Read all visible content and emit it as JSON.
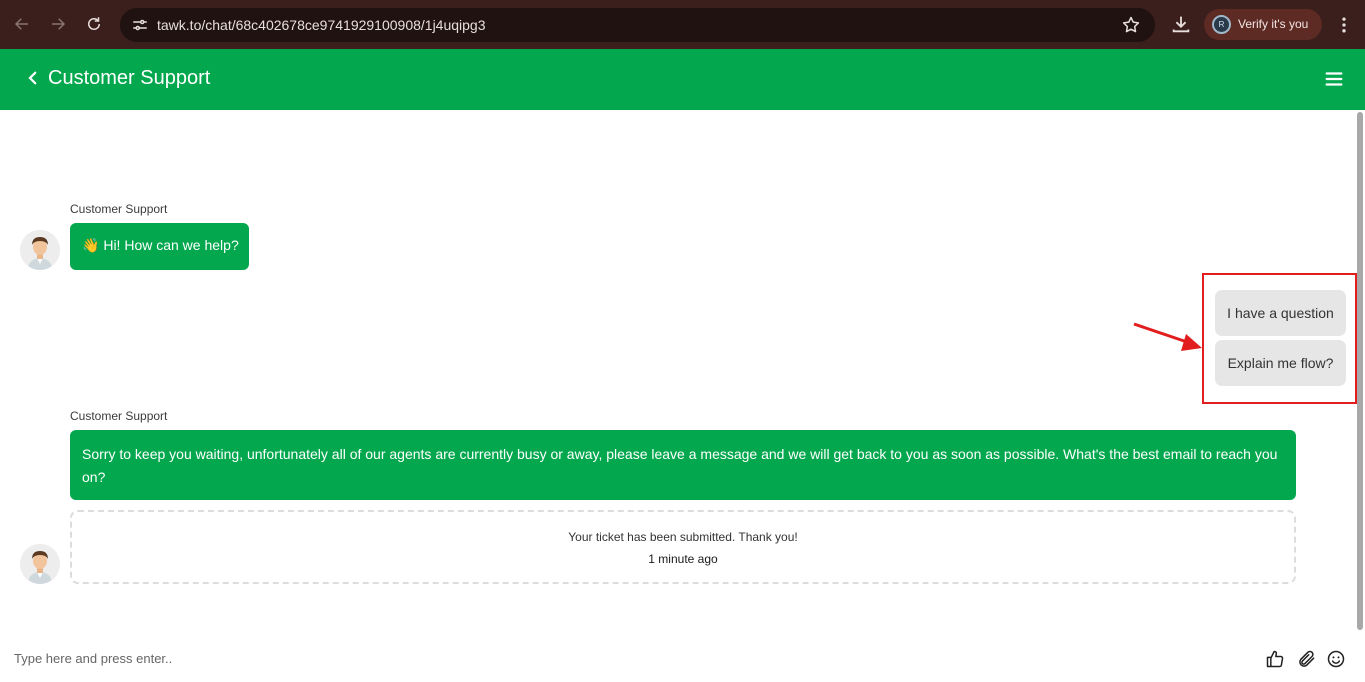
{
  "browser": {
    "url": "tawk.to/chat/68c402678ce9741929100908/1j4uqipg3",
    "profile_initial": "R",
    "verify_label": "Verify it's you"
  },
  "header": {
    "title": "Customer Support"
  },
  "messages": [
    {
      "sender": "Customer Support",
      "emoji": "👋",
      "text": "Hi! How can we help?"
    },
    {
      "sender": "Customer Support",
      "text": "Sorry to keep you waiting, unfortunately all of our agents are currently busy or away, please leave a message and we will get back to you as soon as possible. What's the best email to reach you on?"
    }
  ],
  "quick_replies": [
    "I have a question",
    "Explain me flow?"
  ],
  "ticket": {
    "message": "Your ticket has been submitted. Thank you!",
    "time": "1 minute ago"
  },
  "input": {
    "placeholder": "Type here and press enter.."
  },
  "colors": {
    "brand_green": "#03a84e",
    "browser_bar": "#3a1f1d",
    "annotation_red": "#e21d1d",
    "quick_reply_bg": "#e6e6e6"
  },
  "icons": {
    "back": "back-icon",
    "forward": "forward-icon",
    "reload": "reload-icon",
    "site_info": "tune-icon",
    "bookmark": "star-icon",
    "download": "download-icon",
    "browser_menu": "kebab-icon",
    "chat_back": "chevron-left-icon",
    "chat_menu": "hamburger-icon",
    "like": "thumbs-up-icon",
    "attach": "paperclip-icon",
    "emoji": "smiley-icon"
  }
}
